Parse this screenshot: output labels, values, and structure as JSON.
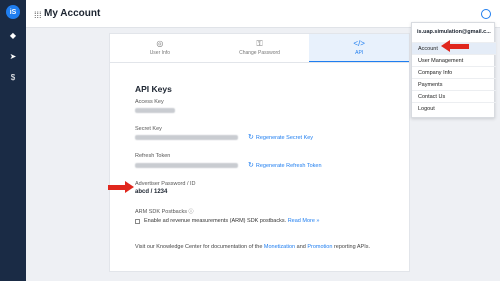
{
  "app": {
    "title": "My Account",
    "logo": "iS"
  },
  "sidebar": {
    "icons": [
      "diamond-icon",
      "rocket-icon",
      "dollar-icon"
    ]
  },
  "tabs": [
    {
      "label": "User Info",
      "icon": "person-icon",
      "active": false
    },
    {
      "label": "Change Password",
      "icon": "key-icon",
      "active": false
    },
    {
      "label": "API",
      "icon": "code-icon",
      "active": true
    }
  ],
  "api": {
    "title": "API Keys",
    "access_key_label": "Access Key",
    "secret_key_label": "Secret Key",
    "regen_secret": "Regenerate Secret Key",
    "refresh_token_label": "Refresh Token",
    "regen_refresh": "Regenerate Refresh Token",
    "advertiser_label": "Advertiser Password / ID",
    "advertiser_value": "abcd / 1234",
    "arm_label": "ARM SDK Postbacks",
    "arm_checkbox": "Enable ad revenue measurements (ARM) SDK postbacks.",
    "read_more": "Read More »",
    "footer_pre": "Visit our Knowledge Center for documentation of the ",
    "footer_link1": "Monetization",
    "footer_mid": " and ",
    "footer_link2": "Promotion",
    "footer_post": " reporting APIs."
  },
  "dropdown": {
    "email": "is.uap.simulation@gmail.c...",
    "items": [
      "Account",
      "User Management",
      "Company Info",
      "Payments",
      "Contact Us",
      "Logout"
    ],
    "active_index": 0
  },
  "colors": {
    "accent": "#1f7ef0",
    "sidebar": "#1a2b45",
    "arrow": "#e0271d"
  }
}
